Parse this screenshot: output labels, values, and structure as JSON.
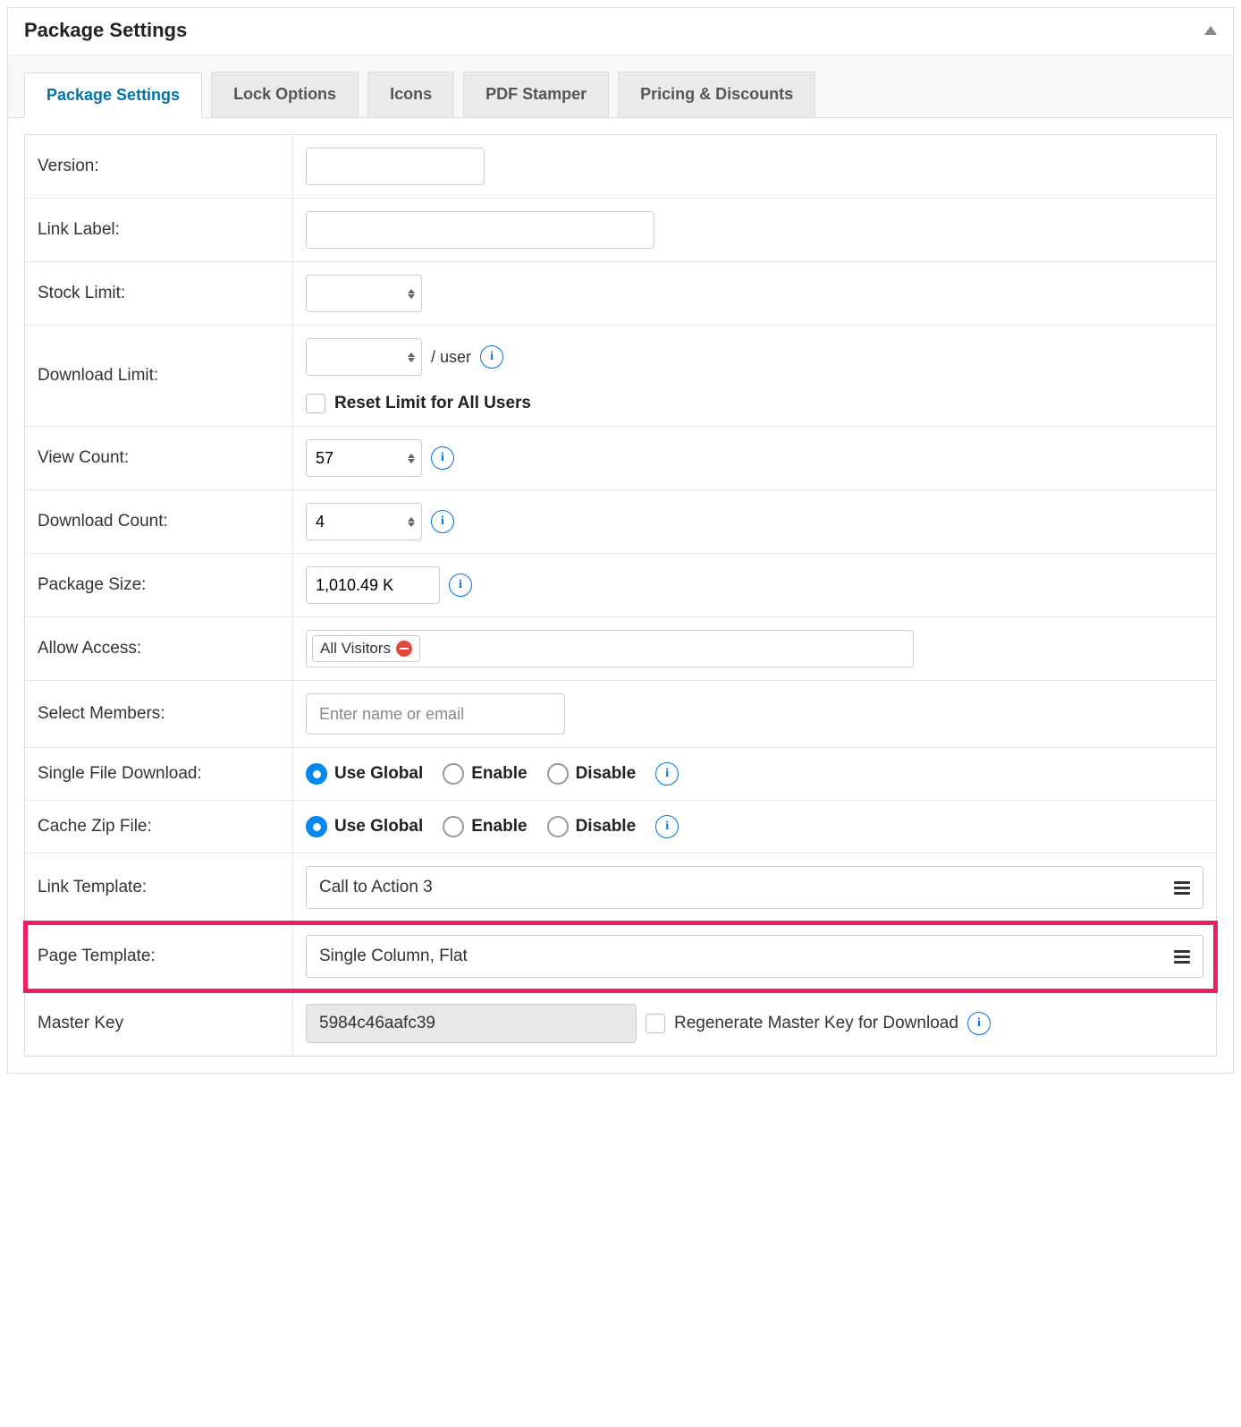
{
  "panel": {
    "title": "Package Settings"
  },
  "tabs": [
    {
      "label": "Package Settings",
      "active": true
    },
    {
      "label": "Lock Options"
    },
    {
      "label": "Icons"
    },
    {
      "label": "PDF Stamper"
    },
    {
      "label": "Pricing & Discounts"
    }
  ],
  "fields": {
    "version": {
      "label": "Version:",
      "value": ""
    },
    "linkLabel": {
      "label": "Link Label:",
      "value": ""
    },
    "stockLimit": {
      "label": "Stock Limit:",
      "value": ""
    },
    "downloadLimit": {
      "label": "Download Limit:",
      "value": "",
      "suffix": "/ user",
      "resetLabel": "Reset Limit for All Users"
    },
    "viewCount": {
      "label": "View Count:",
      "value": "57"
    },
    "downloadCount": {
      "label": "Download Count:",
      "value": "4"
    },
    "packageSize": {
      "label": "Package Size:",
      "value": "1,010.49 K"
    },
    "allowAccess": {
      "label": "Allow Access:",
      "chip": "All Visitors"
    },
    "selectMembers": {
      "label": "Select Members:",
      "placeholder": "Enter name or email"
    },
    "singleFileDownload": {
      "label": "Single File Download:",
      "options": [
        "Use Global",
        "Enable",
        "Disable"
      ],
      "selected": "Use Global"
    },
    "cacheZipFile": {
      "label": "Cache Zip File:",
      "options": [
        "Use Global",
        "Enable",
        "Disable"
      ],
      "selected": "Use Global"
    },
    "linkTemplate": {
      "label": "Link Template:",
      "value": "Call to Action 3"
    },
    "pageTemplate": {
      "label": "Page Template:",
      "value": "Single Column, Flat"
    },
    "masterKey": {
      "label": "Master Key",
      "value": "5984c46aafc39",
      "regenLabel": "Regenerate Master Key for Download"
    }
  }
}
